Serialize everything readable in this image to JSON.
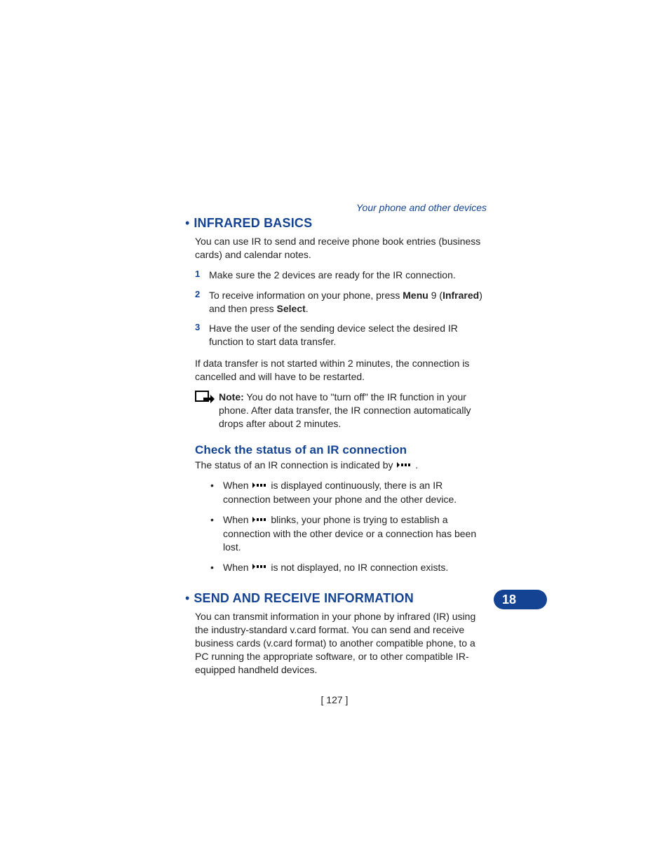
{
  "running_head": "Your phone and other devices",
  "section1": {
    "title": "INFRARED BASICS",
    "intro": "You can use IR to send and receive phone book entries (business cards) and calendar notes.",
    "steps": {
      "s1_num": "1",
      "s1_text": "Make sure the 2 devices are ready for the IR connection.",
      "s2_num": "2",
      "s2_pre": "To receive information on your phone, press ",
      "s2_menu": "Menu",
      "s2_mid": " 9 (",
      "s2_infrared": "Infrared",
      "s2_post1": ") and then press ",
      "s2_select": "Select",
      "s2_end": ".",
      "s3_num": "3",
      "s3_text": "Have the user of the sending device select the desired IR function to start data transfer."
    },
    "after": "If data transfer is not started within 2 minutes, the connection is cancelled and will have to be restarted.",
    "note_label": "Note:",
    "note_text": " You do not have to \"turn off\" the IR function in your phone. After data transfer, the IR connection automatically drops after about 2 minutes."
  },
  "section2": {
    "title": "Check the status of an IR connection",
    "intro_pre": "The status of an IR connection is indicated by ",
    "intro_post": " .",
    "b1_pre": "When  ",
    "b1_post": "  is displayed continuously, there is an IR connection between your phone and the other device.",
    "b2_pre": "When  ",
    "b2_post": "  blinks, your phone is trying to establish a connection with the other device or a connection has been lost.",
    "b3_pre": "When  ",
    "b3_post": "  is not displayed, no IR connection exists."
  },
  "section3": {
    "title": "SEND AND RECEIVE INFORMATION",
    "intro": "You can transmit information in your phone by infrared (IR) using the industry-standard v.card format. You can send and receive business cards (v.card format) to another compatible phone, to a PC running the appropriate software, or to other compatible IR-equipped handheld devices."
  },
  "chapter_number": "18",
  "page_number": "[ 127 ]"
}
